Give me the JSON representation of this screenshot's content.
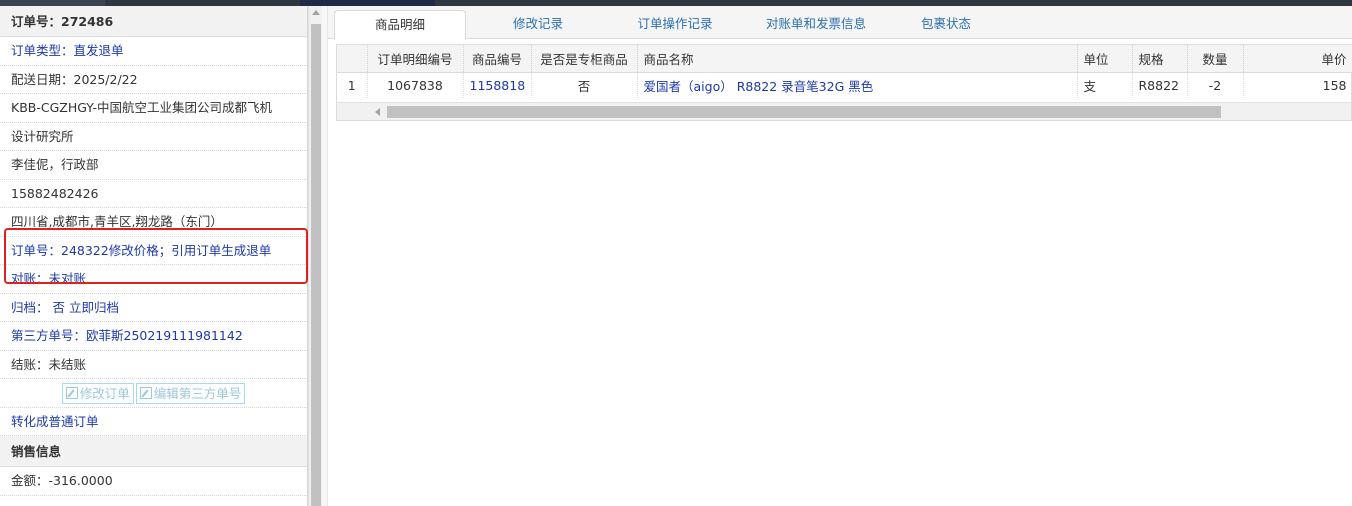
{
  "order_header": {
    "label": "订单号：",
    "value": "272486"
  },
  "order_info": {
    "order_type": {
      "label": "订单类型：",
      "value": "直发退单"
    },
    "delivery_date": "配送日期：2025/2/22",
    "customer_line1": "KBB-CGZHGY-中国航空工业集团公司成都飞机",
    "customer_line2": "设计研究所",
    "contact": "李佳伲，行政部",
    "phone": "15882482426",
    "address": "四川省,成都市,青羊区,翔龙路（东门）",
    "ref_order": "订单号：248322修改价格；引用订单生成退单",
    "reconcile": "对账：未对账",
    "archive_label": "归档：",
    "archive_value": "否",
    "archive_action": "立即归档",
    "third_party": "第三方单号：欧菲斯250219111981142",
    "settlement": "结账：未结账",
    "btn_edit_order": "修改订单",
    "btn_edit_third": "编辑第三方单号",
    "convert_link": "转化成普通订单"
  },
  "sales_section": {
    "title": "销售信息",
    "amount": "金额：-316.0000"
  },
  "tabs": [
    "商品明细",
    "修改记录",
    "订单操作记录",
    "对账单和发票信息",
    "包裹状态"
  ],
  "active_tab": "商品明细",
  "grid": {
    "columns": [
      "",
      "订单明细编号",
      "商品编号",
      "是否是专柜商品",
      "商品名称",
      "单位",
      "规格",
      "数量",
      "单价"
    ],
    "rows": [
      {
        "index": "1",
        "detail_id": "1067838",
        "product_code": "1158818",
        "counter_item": "否",
        "product_name": "爱国者（aigo） R8822 录音笔32G 黑色",
        "unit": "支",
        "spec": "R8822",
        "quantity": "-2",
        "unit_price": "158"
      }
    ]
  },
  "colors": {
    "link": "#1d39a8",
    "highlight_box": "#e02020",
    "tab_text": "#2a6fb0"
  },
  "icons": [
    "edit-icon"
  ]
}
